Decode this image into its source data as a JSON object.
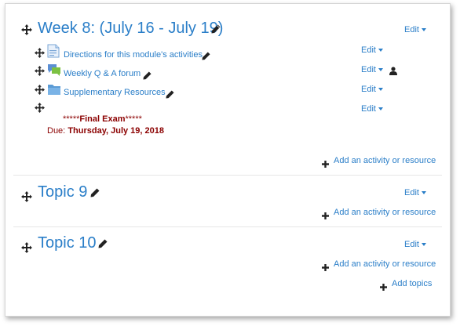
{
  "sections": [
    {
      "title": "Week 8: (July 16 - July 19)",
      "edit_label": "Edit",
      "activities": [
        {
          "name": "Directions for this module's activities.",
          "icon": "page-icon",
          "edit_label": "Edit"
        },
        {
          "name": "Weekly Q & A forum",
          "icon": "forum-icon",
          "edit_label": "Edit"
        },
        {
          "name": "Supplementary Resources",
          "icon": "folder-icon",
          "edit_label": "Edit"
        },
        {
          "edit_label": "Edit"
        }
      ],
      "label": {
        "stars_left": "*****",
        "final_exam": "Final Exam",
        "stars_right": "*****",
        "due_prefix": "Due:",
        "due_date": "Thursday, July 19, 2018"
      },
      "add_label": "Add an activity or resource"
    },
    {
      "title": "Topic 9",
      "edit_label": "Edit",
      "add_label": "Add an activity or resource"
    },
    {
      "title": "Topic 10",
      "edit_label": "Edit",
      "add_label": "Add an activity or resource"
    }
  ],
  "add_topics_label": "Add topics",
  "colors": {
    "link": "#2a7ec8",
    "label": "#8b0000",
    "divider": "#e6e6e6"
  }
}
